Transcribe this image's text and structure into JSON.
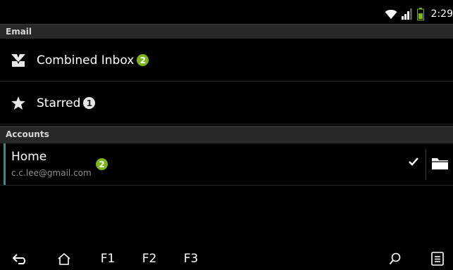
{
  "status_bar": {
    "time": "2:29",
    "icons": [
      "wifi-icon",
      "signal-icon",
      "battery-icon"
    ],
    "battery_color": "#7db31c"
  },
  "email_header": {
    "title": "Email"
  },
  "mailboxes": [
    {
      "label": "Combined Inbox",
      "count": "2",
      "icon": "combined-inbox-icon",
      "badge_color": "#7db31c"
    },
    {
      "label": "Starred",
      "count": "1",
      "icon": "star-icon",
      "badge_color": "#e6e6e6"
    }
  ],
  "accounts_header": {
    "title": "Accounts"
  },
  "account": {
    "name": "Home",
    "email": "c.c.lee@gmail.com",
    "count": "2",
    "accent_color": "#3c8a83"
  },
  "nav_bar": {
    "icons": [
      "back-icon",
      "home-icon",
      "search-icon",
      "menu-icon"
    ],
    "keys": [
      "F1",
      "F2",
      "F3"
    ]
  }
}
